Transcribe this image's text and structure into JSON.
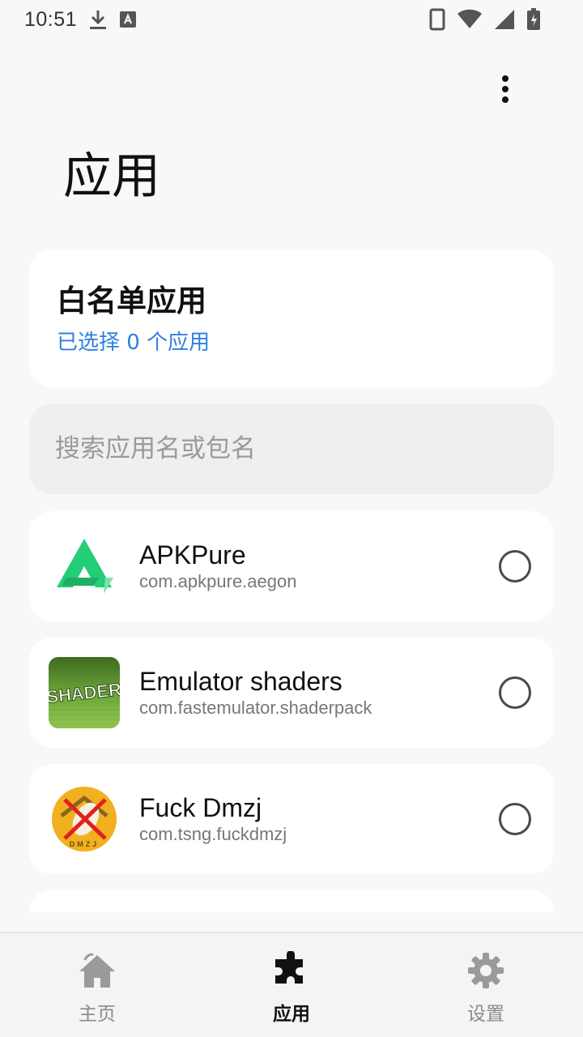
{
  "status_bar": {
    "time": "10:51",
    "icons": [
      "download-icon",
      "a-keyboard-icon",
      "phone-icon",
      "wifi-icon",
      "signal-icon",
      "battery-charging-icon"
    ]
  },
  "header": {
    "title": "应用",
    "menu_icon": "more-vert-icon"
  },
  "whitelist": {
    "title": "白名单应用",
    "subtitle": "已选择 0 个应用"
  },
  "search": {
    "placeholder": "搜索应用名或包名",
    "value": ""
  },
  "apps": [
    {
      "name": "APKPure",
      "package": "com.apkpure.aegon",
      "icon": "apkpure-icon",
      "selected": false
    },
    {
      "name": "Emulator shaders",
      "package": "com.fastemulator.shaderpack",
      "icon": "shader-icon",
      "selected": false,
      "icon_text": "SHADER"
    },
    {
      "name": "Fuck Dmzj",
      "package": "com.tsng.fuckdmzj",
      "icon": "fuckdmzj-icon",
      "selected": false,
      "icon_text": "DMZJ"
    }
  ],
  "bottom_nav": {
    "items": [
      {
        "label": "主页",
        "icon": "home-icon",
        "active": false
      },
      {
        "label": "应用",
        "icon": "puzzle-icon",
        "active": true
      },
      {
        "label": "设置",
        "icon": "gear-icon",
        "active": false
      }
    ]
  },
  "colors": {
    "accent": "#2f7fe0",
    "background": "#f8f8f8",
    "card": "#ffffff",
    "search_bg": "#efefef"
  }
}
